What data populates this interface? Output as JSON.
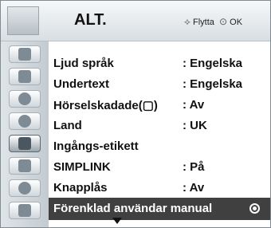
{
  "header": {
    "title": "ALT.",
    "move_label": "Flytta",
    "ok_label": "OK"
  },
  "menu": {
    "items": [
      {
        "label": "Ljud språk",
        "value": ": Engelska"
      },
      {
        "label": "Undertext",
        "value": ": Engelska"
      },
      {
        "label": "Hörselskadade(▢)",
        "value": ": Av"
      },
      {
        "label": "Land",
        "value": ": UK"
      },
      {
        "label": "Ingångs-etikett",
        "value": ""
      },
      {
        "label": "SIMPLINK",
        "value": ": På"
      },
      {
        "label": "Knapplås",
        "value": ": Av"
      },
      {
        "label": "Förenklad användar manual",
        "value": ""
      }
    ],
    "selected_index": 7
  },
  "sidebar": {
    "icons": [
      "picture-icon",
      "screen-icon",
      "audio-icon",
      "time-icon",
      "option-icon",
      "lock-icon",
      "input-icon",
      "usb-icon"
    ],
    "active_index": 4
  },
  "colors": {
    "selected_bg": "#404040"
  }
}
